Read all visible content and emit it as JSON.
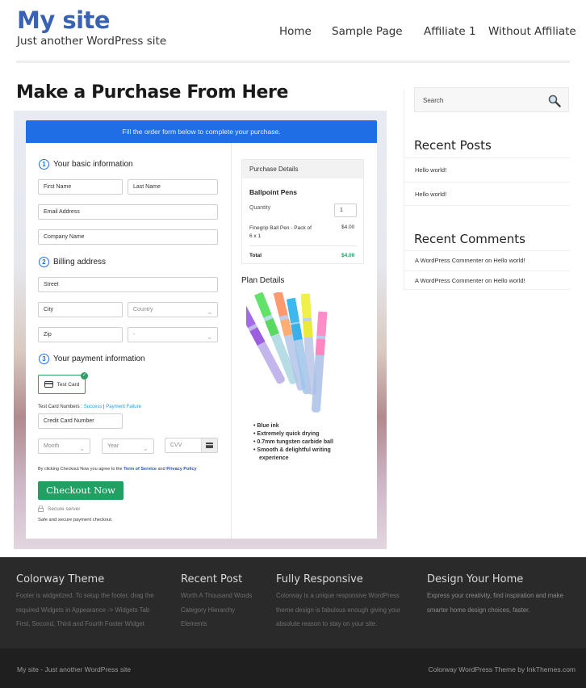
{
  "header": {
    "site_title": "My site",
    "tagline": "Just another WordPress site",
    "nav": [
      "Home",
      "Sample Page",
      "Affiliate 1",
      "Without Affiliate"
    ]
  },
  "page": {
    "title": "Make a Purchase From Here"
  },
  "form": {
    "banner": "Fill the order form below to complete your purchase.",
    "steps": [
      {
        "num": "1",
        "label": "Your basic information"
      },
      {
        "num": "2",
        "label": "Billing address"
      },
      {
        "num": "3",
        "label": "Your payment information"
      }
    ],
    "placeholders": {
      "first_name": "First Name",
      "last_name": "Last Name",
      "email": "Email Address",
      "company": "Company Name",
      "street": "Street",
      "city": "City",
      "country": "Country",
      "zip": "Zip",
      "state": "-",
      "card_number": "Credit Card Number",
      "month": "Month",
      "year": "Year",
      "cvv": "CVV"
    },
    "payment_method": "Test Card",
    "test_card_label": "Test Card Numbers : ",
    "test_success": "Success",
    "test_sep": " | ",
    "test_failure": "Payment Failure",
    "agree_prefix": "By clicking Checkout Now you agree to the ",
    "terms": "Term of Service",
    "agree_and": " and ",
    "privacy": "Privacy Policy",
    "checkout_button": "Checkout Now",
    "secure_server": "Secure server",
    "safe_text": "Safe and secure payment checkout."
  },
  "purchase": {
    "header": "Purchase Details",
    "product": "Ballpoint Pens",
    "quantity_label": "Quantity",
    "quantity_value": "1",
    "item_name": "Finegrip Ball Pen - Pack of 6 x 1",
    "item_price": "$4.00",
    "total_label": "Total",
    "total_value": "$4.00",
    "plan_title": "Plan Details",
    "features": [
      "Blue ink",
      "Extremely quick drying",
      "0.7mm tungsten carbide ball",
      "Smooth & delightful writing experience"
    ]
  },
  "sidebar": {
    "search_placeholder": "Search",
    "recent_posts_title": "Recent Posts",
    "recent_posts": [
      "Hello world!",
      "Hello world!"
    ],
    "recent_comments_title": "Recent Comments",
    "recent_comments": [
      {
        "author": "A WordPress Commenter",
        "on": " on ",
        "post": "Hello world!"
      },
      {
        "author": "A WordPress Commenter",
        "on": " on ",
        "post": "Hello world!"
      }
    ]
  },
  "footer": {
    "columns": [
      {
        "title": "Colorway Theme",
        "lines": [
          "Footer is widgetized. To setup the footer, drag the",
          "required Widgets in Appearance -> Widgets Tab",
          "First, Second, Third and Fourth Footer Widget"
        ]
      },
      {
        "title": "Recent Post",
        "lines": [
          "Worth A Thousand Words",
          "Category Hierarchy",
          "Elements"
        ]
      },
      {
        "title": "Fully Responsive",
        "lines": [
          "Colorway is a unique responsive WordPress",
          "theme design is fabulous enough giving your",
          "absolute reason to stay on your site."
        ]
      },
      {
        "title": "Design Your Home",
        "lines": [
          "Express your creativity, find inspiration and make",
          "smarter home design choices, faster."
        ]
      }
    ],
    "bottom_left": "My site - Just another WordPress site",
    "bottom_right": "Colorway WordPress Theme by InkThemes.com"
  },
  "colors": {
    "brand": "#3a62b3",
    "banner": "#1f6ee6",
    "checkout": "#22a063",
    "total": "#22a063"
  }
}
